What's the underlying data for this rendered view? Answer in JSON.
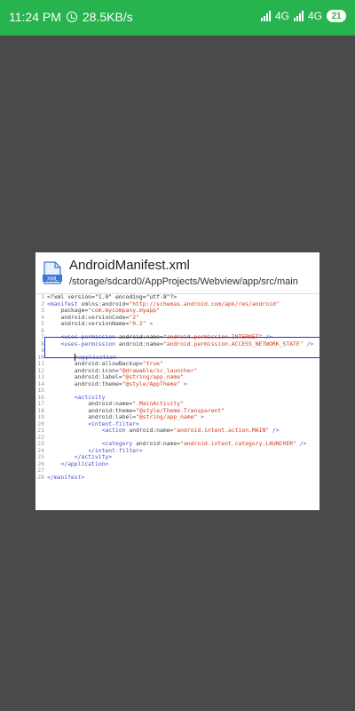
{
  "status_bar": {
    "time": "11:24 PM",
    "speed": "28.5KB/s",
    "sim1": "4G",
    "sim2": "4G",
    "battery": "21",
    "bg_color": "#27b34e"
  },
  "file": {
    "icon": "xml-file-icon",
    "icon_label": "XML",
    "title": "AndroidManifest.xml",
    "path": "/storage/sdcard0/AppProjects/Webview/app/src/main"
  },
  "code": {
    "highlight_color": "#2233cc",
    "lines": [
      {
        "n": "1",
        "indent": 0,
        "tokens": [
          [
            "p",
            "<?xml version=\"1.0\" encoding=\"utf-8\"?>"
          ]
        ]
      },
      {
        "n": "2",
        "indent": 0,
        "tokens": [
          [
            "t",
            "<manifest "
          ],
          [
            "a",
            "xmlns:android="
          ],
          [
            "v",
            "\"http://schemas.android.com/apk/res/android\""
          ]
        ]
      },
      {
        "n": "3",
        "indent": 4,
        "tokens": [
          [
            "a",
            "package="
          ],
          [
            "v",
            "\"com.mycompany.myapp\""
          ]
        ]
      },
      {
        "n": "4",
        "indent": 4,
        "tokens": [
          [
            "a",
            "android:versionCode="
          ],
          [
            "v",
            "\"2\""
          ]
        ]
      },
      {
        "n": "5",
        "indent": 4,
        "tokens": [
          [
            "a",
            "android:versionName="
          ],
          [
            "v",
            "\"0.2\""
          ],
          [
            "t",
            " >"
          ]
        ]
      },
      {
        "n": "6",
        "indent": 0,
        "tokens": []
      },
      {
        "n": "7",
        "indent": 4,
        "tokens": [
          [
            "t",
            "<uses-permission "
          ],
          [
            "a",
            "android:name="
          ],
          [
            "v",
            "\"android.permission.INTERNET\""
          ],
          [
            "t",
            " />"
          ]
        ]
      },
      {
        "n": "8",
        "indent": 4,
        "tokens": [
          [
            "t",
            "<uses-permission "
          ],
          [
            "a",
            "android:name="
          ],
          [
            "v",
            "\"android.permission.ACCESS_NETWORK_STATE\""
          ],
          [
            "t",
            " />"
          ]
        ]
      },
      {
        "n": "9",
        "indent": 0,
        "tokens": []
      },
      {
        "n": "10",
        "indent": 8,
        "tokens": [
          [
            "t",
            "<application"
          ]
        ]
      },
      {
        "n": "11",
        "indent": 8,
        "tokens": [
          [
            "a",
            "android:allowBackup="
          ],
          [
            "v",
            "\"true\""
          ]
        ]
      },
      {
        "n": "12",
        "indent": 8,
        "tokens": [
          [
            "a",
            "android:icon="
          ],
          [
            "v",
            "\"@drawable/ic_launcher\""
          ]
        ]
      },
      {
        "n": "13",
        "indent": 8,
        "tokens": [
          [
            "a",
            "android:label="
          ],
          [
            "v",
            "\"@string/app_name\""
          ]
        ]
      },
      {
        "n": "14",
        "indent": 8,
        "tokens": [
          [
            "a",
            "android:theme="
          ],
          [
            "v",
            "\"@style/AppTheme\""
          ],
          [
            "t",
            " >"
          ]
        ]
      },
      {
        "n": "15",
        "indent": 0,
        "tokens": []
      },
      {
        "n": "16",
        "indent": 8,
        "tokens": [
          [
            "t",
            "<activity"
          ]
        ]
      },
      {
        "n": "17",
        "indent": 12,
        "tokens": [
          [
            "a",
            "android:name="
          ],
          [
            "v",
            "\".MainActivity\""
          ]
        ]
      },
      {
        "n": "18",
        "indent": 12,
        "tokens": [
          [
            "a",
            "android:theme="
          ],
          [
            "v",
            "\"@style/Theme.Transparent\""
          ]
        ]
      },
      {
        "n": "19",
        "indent": 12,
        "tokens": [
          [
            "a",
            "android:label="
          ],
          [
            "v",
            "\"@string/app_name\""
          ],
          [
            "t",
            " >"
          ]
        ]
      },
      {
        "n": "20",
        "indent": 12,
        "tokens": [
          [
            "t",
            "<intent-filter>"
          ]
        ]
      },
      {
        "n": "21",
        "indent": 16,
        "tokens": [
          [
            "t",
            "<action "
          ],
          [
            "a",
            "android:name="
          ],
          [
            "v",
            "\"android.intent.action.MAIN\""
          ],
          [
            "t",
            " />"
          ]
        ]
      },
      {
        "n": "22",
        "indent": 0,
        "tokens": []
      },
      {
        "n": "23",
        "indent": 16,
        "tokens": [
          [
            "t",
            "<category "
          ],
          [
            "a",
            "android:name="
          ],
          [
            "v",
            "\"android.intent.category.LAUNCHER\""
          ],
          [
            "t",
            " />"
          ]
        ]
      },
      {
        "n": "24",
        "indent": 12,
        "tokens": [
          [
            "t",
            "</intent-filter>"
          ]
        ]
      },
      {
        "n": "25",
        "indent": 8,
        "tokens": [
          [
            "t",
            "</activity>"
          ]
        ]
      },
      {
        "n": "26",
        "indent": 4,
        "tokens": [
          [
            "t",
            "</application>"
          ]
        ]
      },
      {
        "n": "27",
        "indent": 0,
        "tokens": []
      },
      {
        "n": "28",
        "indent": 0,
        "tokens": [
          [
            "t",
            "</manifest>"
          ]
        ]
      }
    ]
  }
}
